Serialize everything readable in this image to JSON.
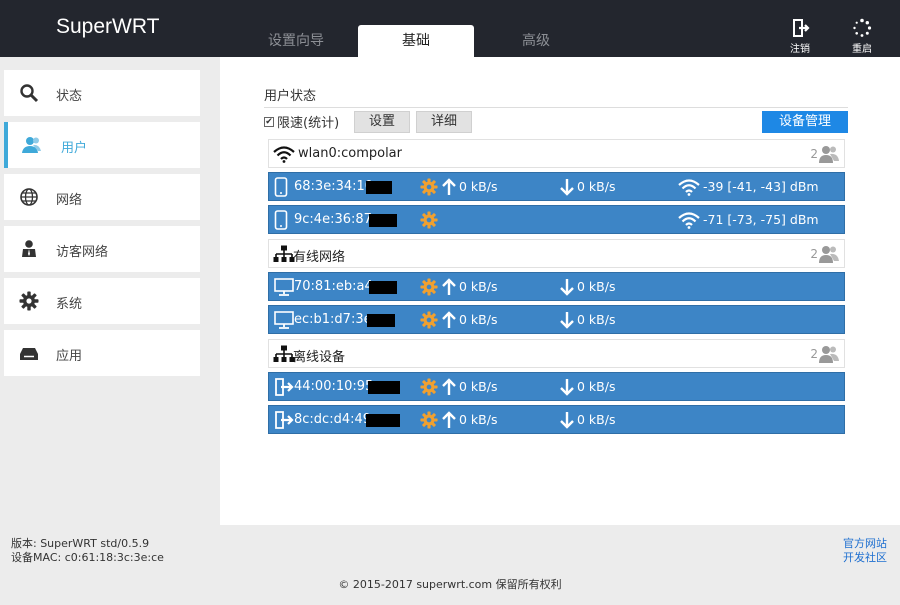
{
  "app": {
    "title": "SuperWRT"
  },
  "tabs": [
    {
      "label": "设置向导",
      "active": false
    },
    {
      "label": "基础",
      "active": true
    },
    {
      "label": "高级",
      "active": false
    }
  ],
  "top_actions": {
    "logout_label": "注销",
    "reboot_label": "重启"
  },
  "sidebar": {
    "items": [
      {
        "label": "状态",
        "icon": "search-icon"
      },
      {
        "label": "用户",
        "icon": "user-icon",
        "active": true
      },
      {
        "label": "网络",
        "icon": "globe-icon"
      },
      {
        "label": "访客网络",
        "icon": "guest-icon"
      },
      {
        "label": "系统",
        "icon": "gear-icon"
      },
      {
        "label": "应用",
        "icon": "app-icon"
      }
    ]
  },
  "main": {
    "title": "用户状态",
    "limit_label": "限速(统计)",
    "limit_checked": true,
    "settings_button": "设置",
    "details_button": "详细",
    "manage_button": "设备管理",
    "groups": [
      {
        "name": "wlan0:compolar",
        "icon": "wifi-icon",
        "count": "2",
        "devices": [
          {
            "mac": "68:3e:34:10:",
            "type": "phone",
            "up": "0 kB/s",
            "down": "0 kB/s",
            "signal": "-39 [-41, -43] dBm"
          },
          {
            "mac": "9c:4e:36:87:",
            "type": "phone",
            "signal": "-71 [-73, -75] dBm"
          }
        ]
      },
      {
        "name": "有线网络",
        "icon": "network-icon",
        "count": "2",
        "devices": [
          {
            "mac": "70:81:eb:a4:",
            "type": "desktop",
            "up": "0 kB/s",
            "down": "0 kB/s"
          },
          {
            "mac": "ec:b1:d7:3e:",
            "type": "desktop",
            "up": "0 kB/s",
            "down": "0 kB/s"
          }
        ]
      },
      {
        "name": "离线设备",
        "icon": "network-icon",
        "count": "2",
        "devices": [
          {
            "mac": "44:00:10:95:",
            "type": "offline",
            "up": "0 kB/s",
            "down": "0 kB/s"
          },
          {
            "mac": "8c:dc:d4:49:",
            "type": "offline",
            "up": "0 kB/s",
            "down": "0 kB/s"
          }
        ]
      }
    ]
  },
  "footer": {
    "version": "版本: SuperWRT std/0.5.9",
    "mac": "设备MAC: c0:61:18:3c:3e:ce",
    "official_site": "官方网站",
    "dev_community": "开发社区",
    "copyright": "© 2015-2017 superwrt.com 保留所有权利"
  },
  "colors": {
    "topbar": "#23262e",
    "accent": "#3fa9d9",
    "row": "#3d85c6",
    "gear": "#f0a030",
    "manage": "#1e88e5"
  }
}
